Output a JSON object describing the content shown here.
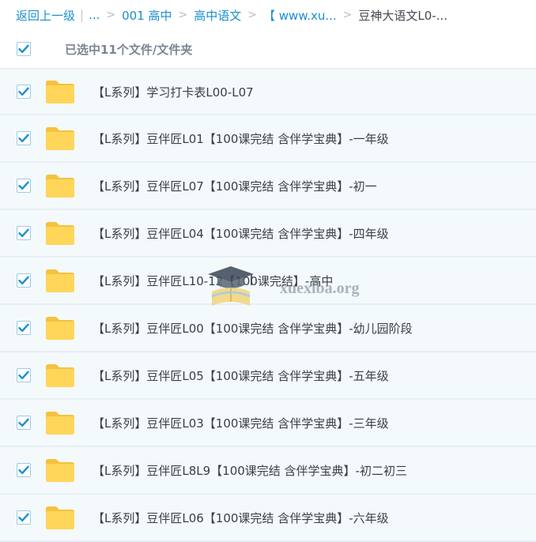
{
  "breadcrumb": {
    "back": "返回上一级",
    "ellipsis": "...",
    "items": [
      "001 高中",
      "高中语文",
      "【 www.xu..."
    ],
    "current": "豆神大语文L0-..."
  },
  "selection": {
    "label": "已选中11个文件/文件夹",
    "checked": true
  },
  "files": [
    {
      "name": "【L系列】学习打卡表L00-L07",
      "checked": true,
      "icon": "folder-icon"
    },
    {
      "name": "【L系列】豆伴匠L01【100课完结 含伴学宝典】-一年级",
      "checked": true,
      "icon": "folder-icon"
    },
    {
      "name": "【L系列】豆伴匠L07【100课完结 含伴学宝典】-初一",
      "checked": true,
      "icon": "folder-icon"
    },
    {
      "name": "【L系列】豆伴匠L04【100课完结 含伴学宝典】-四年级",
      "checked": true,
      "icon": "folder-icon"
    },
    {
      "name": "【L系列】豆伴匠L10-12【100课完结】-高中",
      "checked": true,
      "icon": "folder-icon"
    },
    {
      "name": "【L系列】豆伴匠L00【100课完结 含伴学宝典】-幼儿园阶段",
      "checked": true,
      "icon": "folder-icon"
    },
    {
      "name": "【L系列】豆伴匠L05【100课完结 含伴学宝典】-五年级",
      "checked": true,
      "icon": "folder-icon"
    },
    {
      "name": "【L系列】豆伴匠L03【100课完结 含伴学宝典】-三年级",
      "checked": true,
      "icon": "folder-icon"
    },
    {
      "name": "【L系列】豆伴匠L8L9【100课完结 含伴学宝典】-初二初三",
      "checked": true,
      "icon": "folder-icon"
    },
    {
      "name": "【L系列】豆伴匠L06【100课完结 含伴学宝典】-六年级",
      "checked": true,
      "icon": "folder-icon"
    }
  ],
  "watermark": {
    "text": "xuexiba.org"
  },
  "colors": {
    "link": "#1a8fd0",
    "checkbox": "#1a8fd0",
    "folder": "#ffd55a",
    "row_bg": "#f4f9fc"
  }
}
